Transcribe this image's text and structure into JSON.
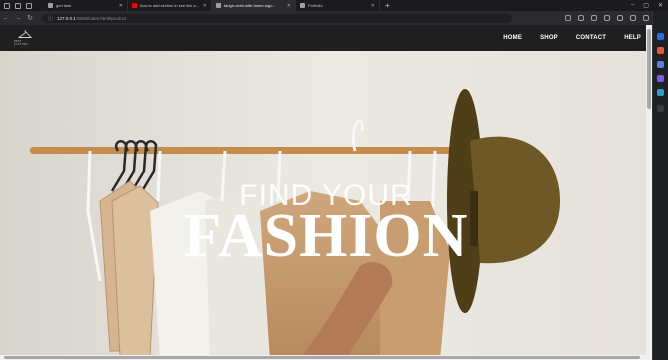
{
  "browser": {
    "tabs": [
      {
        "label": "grid task",
        "favicon": "doc-icon",
        "active": false
      },
      {
        "label": "how to add section in see link a...",
        "favicon": "youtube-icon",
        "active": false
      },
      {
        "label": "tangir-cloth-with-home-logo...",
        "favicon": "doc-icon",
        "active": true
      },
      {
        "label": "Portfolio",
        "favicon": "doc-icon",
        "active": false
      }
    ],
    "address": {
      "host": "127.0.0.1",
      "path": ":5500/index.html#product"
    }
  },
  "site": {
    "logo_text": "BEST CLOTHES",
    "nav": [
      {
        "label": "HOME"
      },
      {
        "label": "SHOP"
      },
      {
        "label": "CONTACT"
      },
      {
        "label": "HELP"
      }
    ],
    "hero": {
      "small": "FIND YOUR",
      "big": "FASHION"
    }
  },
  "colors": {
    "navbar": "#1f1f20",
    "hero_background": "#ebe8e2",
    "hat": "#5b4a1e"
  }
}
